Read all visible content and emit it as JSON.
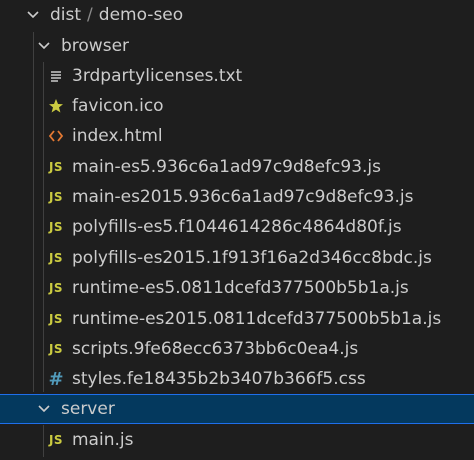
{
  "header": {
    "folder": "dist",
    "separator": "/",
    "subfolder": "demo-seo"
  },
  "browser": {
    "folder": "browser",
    "files": [
      {
        "name": "3rdpartylicenses.txt",
        "icon": "text-lines-icon"
      },
      {
        "name": "favicon.ico",
        "icon": "star-icon"
      },
      {
        "name": "index.html",
        "icon": "html-brackets-icon"
      },
      {
        "name": "main-es5.936c6a1ad97c9d8efc93.js",
        "icon": "js-icon"
      },
      {
        "name": "main-es2015.936c6a1ad97c9d8efc93.js",
        "icon": "js-icon"
      },
      {
        "name": "polyfills-es5.f1044614286c4864d80f.js",
        "icon": "js-icon"
      },
      {
        "name": "polyfills-es2015.1f913f16a2d346cc8bdc.js",
        "icon": "js-icon"
      },
      {
        "name": "runtime-es5.0811dcefd377500b5b1a.js",
        "icon": "js-icon"
      },
      {
        "name": "runtime-es2015.0811dcefd377500b5b1a.js",
        "icon": "js-icon"
      },
      {
        "name": "scripts.9fe68ecc6373bb6c0ea4.js",
        "icon": "js-icon"
      },
      {
        "name": "styles.fe18435b2b3407b366f5.css",
        "icon": "css-hash-icon"
      }
    ]
  },
  "server": {
    "folder": "server",
    "files": [
      {
        "name": "main.js",
        "icon": "js-icon"
      }
    ]
  },
  "icon_glyphs": {
    "js": "JS",
    "css": "#"
  },
  "colors": {
    "background": "#1e1e1e",
    "text": "#cccccc",
    "js_icon": "#cbcb41",
    "css_icon": "#519aba",
    "html_icon": "#e37933",
    "star_icon": "#cbcb41",
    "selected_bg": "#04395e",
    "selected_border": "#1f6feb"
  }
}
